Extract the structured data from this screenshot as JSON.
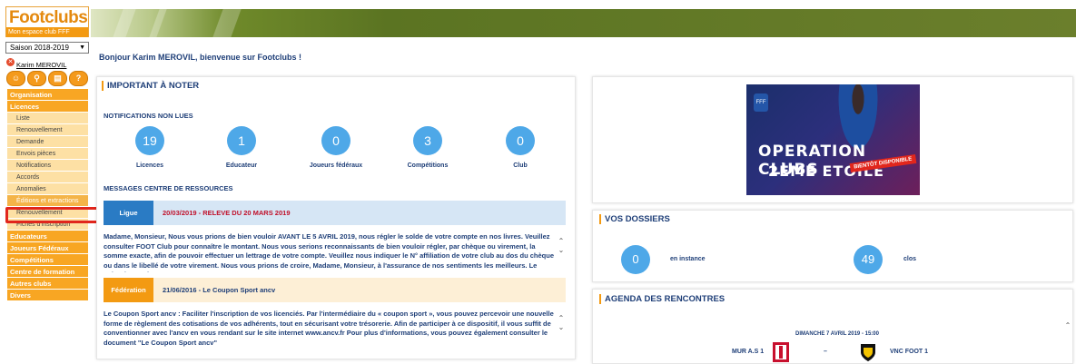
{
  "logo": {
    "word_foot": "Foot",
    "word_clubs": "clubs",
    "subtitle": "Mon espace club FFF"
  },
  "sidebar": {
    "season": "Saison 2018-2019",
    "user_name": "Karim MEROVIL",
    "quick_icons": [
      "user-icon",
      "search-icon",
      "document-icon",
      "help-icon"
    ],
    "menu": [
      {
        "label": "Organisation",
        "type": "main"
      },
      {
        "label": "Licences",
        "type": "main"
      },
      {
        "label": "Liste",
        "type": "sub"
      },
      {
        "label": "Renouvellement",
        "type": "sub"
      },
      {
        "label": "Demande",
        "type": "sub"
      },
      {
        "label": "Envois pièces",
        "type": "sub"
      },
      {
        "label": "Notifications",
        "type": "sub"
      },
      {
        "label": "Accords",
        "type": "sub"
      },
      {
        "label": "Anomalies",
        "type": "sub"
      },
      {
        "label": "Éditions et extractions",
        "type": "sub",
        "active": true
      },
      {
        "label": "Renouvellement",
        "type": "sub"
      },
      {
        "label": "Fiches d'inscription",
        "type": "sub"
      },
      {
        "label": "Educateurs",
        "type": "main"
      },
      {
        "label": "Joueurs Fédéraux",
        "type": "main"
      },
      {
        "label": "Compétitions",
        "type": "main"
      },
      {
        "label": "Centre de formation",
        "type": "main"
      },
      {
        "label": "Autres clubs",
        "type": "main"
      },
      {
        "label": "Divers",
        "type": "main"
      }
    ]
  },
  "welcome": "Bonjour Karim MEROVIL, bienvenue sur Footclubs !",
  "important": {
    "title": "IMPORTANT À NOTER",
    "notifications_label": "NOTIFICATIONS NON LUES",
    "notifications": [
      {
        "count": "19",
        "label": "Licences"
      },
      {
        "count": "1",
        "label": "Educateur"
      },
      {
        "count": "0",
        "label": "Joueurs fédéraux"
      },
      {
        "count": "3",
        "label": "Compétitions"
      },
      {
        "count": "0",
        "label": "Club"
      }
    ],
    "messages_label": "MESSAGES CENTRE DE RESSOURCES",
    "messages": [
      {
        "tag": "Ligue",
        "tag_color": "#2a7bc4",
        "header_bg": "#d6e6f5",
        "title": "20/03/2019 - RELEVE DU 20 MARS 2019",
        "title_color": "#c0102a",
        "body": "Madame, Monsieur, Nous vous prions de bien vouloir AVANT LE 5 AVRIL 2019, nous régler le solde de votre compte en nos livres. Veuillez consulter FOOT Club pour connaître le montant. Nous vous serions reconnaissants de bien vouloir régler, par chèque ou virement, la somme exacte, afin de pouvoir effectuer un lettrage de votre compte. Veuillez nous indiquer le N° affiliation de votre club au dos du chèque ou dans le libellé de votre virement. Nous vous prions de croire, Madame, Monsieur, à l'assurance de nos sentiments les meilleurs. Le Trésorier Paul"
      },
      {
        "tag": "Fédération",
        "tag_color": "#f39a12",
        "header_bg": "#fdefd6",
        "title": "21/06/2016 - Le Coupon Sport ancv",
        "title_color": "#1f3f78",
        "body": "Le Coupon Sport ancv : Faciliter l'inscription de vos licenciés. Par l'intermédiaire du « coupon sport », vous pouvez percevoir une nouvelle forme de règlement des cotisations de vos adhérents, tout en sécurisant votre trésorerie. Afin de participer à ce dispositif, il vous suffit de conventionner avec l'ancv en vous rendant sur le site internet www.ancv.fr Pour plus d'informations, vous pouvez également consulter le document \"Le Coupon Sport ancv\""
      }
    ]
  },
  "promo": {
    "line1": "OPERATION CLUBS",
    "line2": "2ÈME ETOILE",
    "tag": "BIENTÔT DISPONIBLE",
    "badge": "FFF"
  },
  "dossiers": {
    "title": "VOS DOSSIERS",
    "items": [
      {
        "count": "0",
        "label": "en instance"
      },
      {
        "count": "49",
        "label": "clos"
      }
    ]
  },
  "agenda": {
    "title": "AGENDA DES RENCONTRES",
    "date": "DIMANCHE 7 AVRIL 2019 - 15:00",
    "home": "MUR A.S 1",
    "separator": "–",
    "away": "VNC FOOT 1"
  }
}
